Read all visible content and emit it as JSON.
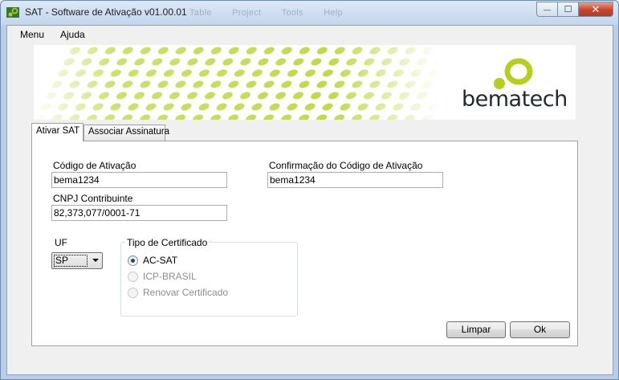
{
  "window": {
    "title": "SAT - Software de Ativação v01.00.01",
    "ghost_menu": [
      "Table",
      "Project",
      "Tools",
      "Help"
    ],
    "controls": {
      "minimize": "—",
      "maximize": "☐",
      "close": "✕"
    }
  },
  "menubar": {
    "items": [
      "Menu",
      "Ajuda"
    ]
  },
  "banner": {
    "brand": "bematech",
    "accent_color": "#b6cf1f"
  },
  "tabs": [
    {
      "label": "Ativar SAT",
      "active": true
    },
    {
      "label": "Associar Assinatura",
      "active": false
    }
  ],
  "form": {
    "codigo_label": "Código de Ativação",
    "codigo_value": "bema1234",
    "confirmacao_label": "Confirmação do Código de Ativação",
    "confirmacao_value": "bema1234",
    "cnpj_label": "CNPJ Contribuinte",
    "cnpj_value": "82,373,077/0001-71",
    "uf_label": "UF",
    "uf_value": "SP",
    "certificado_title": "Tipo de Certificado",
    "certificado_options": [
      {
        "label": "AC-SAT",
        "selected": true,
        "enabled": true
      },
      {
        "label": "ICP-BRASIL",
        "selected": false,
        "enabled": false
      },
      {
        "label": "Renovar Certificado",
        "selected": false,
        "enabled": false
      }
    ]
  },
  "buttons": {
    "limpar": "Limpar",
    "ok": "Ok"
  }
}
